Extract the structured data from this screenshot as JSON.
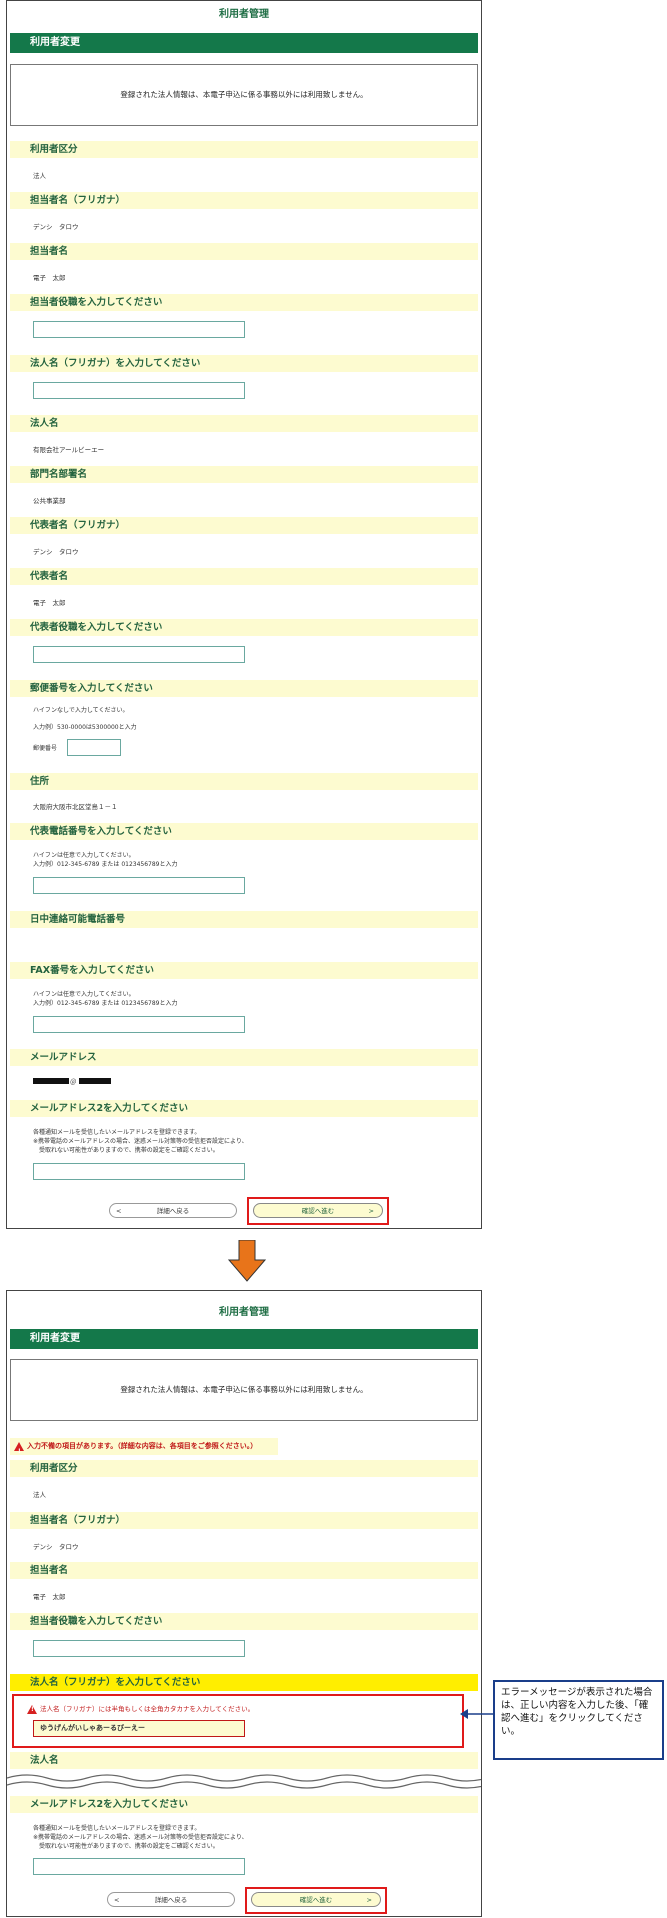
{
  "page_title": "利用者管理",
  "section_title": "利用者変更",
  "notice": "登録された法人情報は、本電子申込に係る事務以外には利用致しません。",
  "fields": {
    "user_type": {
      "label": "利用者区分",
      "value": "法人"
    },
    "contact_kana": {
      "label": "担当者名（フリガナ）",
      "value": "デンシ　タロウ"
    },
    "contact_name": {
      "label": "担当者名",
      "value": "電子　太郎"
    },
    "contact_title": {
      "label": "担当者役職を入力してください"
    },
    "corp_kana": {
      "label": "法人名（フリガナ）を入力してください"
    },
    "corp_name": {
      "label": "法人名",
      "value": "有限会社アールビーエー"
    },
    "dept": {
      "label": "部門名部署名",
      "value": "公共事業部"
    },
    "rep_kana": {
      "label": "代表者名（フリガナ）",
      "value": "デンシ　タロウ"
    },
    "rep_name": {
      "label": "代表者名",
      "value": "電子　太郎"
    },
    "rep_title": {
      "label": "代表者役職を入力してください"
    },
    "postal": {
      "label": "郵便番号を入力してください",
      "help1": "ハイフンなしで入力してください。",
      "help2": "入力例）530-0000は5300000と入力",
      "sublabel": "郵便番号"
    },
    "address": {
      "label": "住所",
      "value": "大阪府大阪市北区堂島１－１"
    },
    "rep_phone": {
      "label": "代表電話番号を入力してください",
      "help1": "ハイフンは任意で入力してください。",
      "help2": "入力例）012-345-6789 または 0123456789と入力"
    },
    "day_phone": {
      "label": "日中連絡可能電話番号"
    },
    "fax": {
      "label": "FAX番号を入力してください",
      "help1": "ハイフンは任意で入力してください。",
      "help2": "入力例）012-345-6789 または 0123456789と入力"
    },
    "email": {
      "label": "メールアドレス",
      "value_mid": "＠"
    },
    "email2": {
      "label": "メールアドレス2を入力してください",
      "help1": "各種通知メールを受信したいメールアドレスを登録できます。",
      "help2": "※携帯電話のメールアドレスの場合、迷惑メール対策等の受信拒否設定により、",
      "help3": "受取れない可能性がありますので、携帯の設定をご確認ください。"
    }
  },
  "buttons": {
    "back": "詳細へ戻る",
    "next": "確認へ進む",
    "back_arrow": "<",
    "next_arrow": ">"
  },
  "error": {
    "summary": "入力不備の項目があります。（詳細な内容は、各項目をご参照ください。）",
    "field_msg": "法人名（フリガナ）には半角もしくは全角カタカナを入力してください。",
    "field_value": "ゆうげんがいしゃあーるびーえー"
  },
  "callout": "エラーメッセージが表示された場合は、正しい内容を入力した後、「確認へ進む」をクリックしてください。",
  "colors": {
    "green": "#14784a",
    "label_bg": "#fdfbd0",
    "error_label_bg": "#ffee00",
    "red": "#e01a1a",
    "arrow": "#e8741a",
    "callout_border": "#1a3e8a"
  }
}
